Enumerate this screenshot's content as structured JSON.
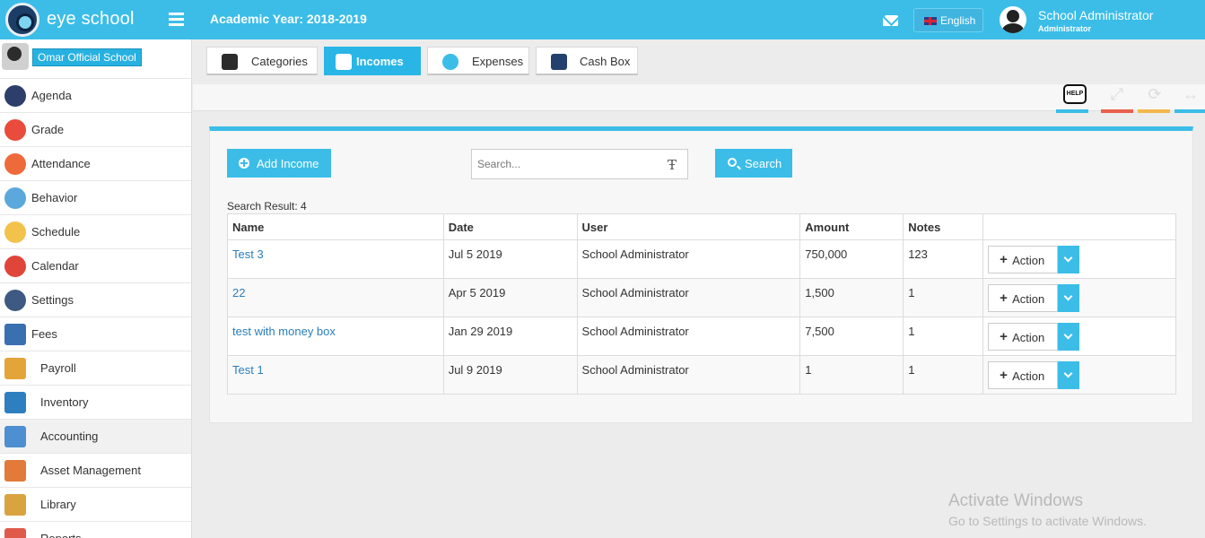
{
  "header": {
    "brand": "eye school",
    "academic_year": "Academic Year: 2018-2019",
    "language": "English",
    "user_name": "School Administrator",
    "user_role": "Administrator"
  },
  "sidebar": {
    "school_name": "Omar Official School",
    "items": [
      {
        "label": "Agenda",
        "icon": "agenda-icon",
        "color": "#2d3e6b"
      },
      {
        "label": "Grade",
        "icon": "grade-icon",
        "color": "#e94b3c"
      },
      {
        "label": "Attendance",
        "icon": "attendance-icon",
        "color": "#ef6a3a"
      },
      {
        "label": "Behavior",
        "icon": "behavior-icon",
        "color": "#5aa8dc"
      },
      {
        "label": "Schedule",
        "icon": "schedule-icon",
        "color": "#f3c24a"
      },
      {
        "label": "Calendar",
        "icon": "calendar-icon",
        "color": "#e0453a"
      },
      {
        "label": "Settings",
        "icon": "settings-icon",
        "color": "#3f5a82"
      },
      {
        "label": "Fees",
        "icon": "fees-icon",
        "color": "#3a6fb0"
      },
      {
        "label": "Payroll",
        "icon": "payroll-icon",
        "color": "#e3a53a"
      },
      {
        "label": "Inventory",
        "icon": "inventory-icon",
        "color": "#2e7fbf"
      },
      {
        "label": "Accounting",
        "icon": "accounting-icon",
        "color": "#4d8fd1"
      },
      {
        "label": "Asset Management",
        "icon": "asset-management-icon",
        "color": "#e27a3a"
      },
      {
        "label": "Library",
        "icon": "library-icon",
        "color": "#d9a340"
      },
      {
        "label": "Reports",
        "icon": "reports-icon",
        "color": "#e05a4a"
      }
    ]
  },
  "tabs": [
    {
      "label": "Categories",
      "icon": "categories-icon",
      "color": "#2b2b2b"
    },
    {
      "label": "Incomes",
      "icon": "incomes-icon",
      "color": "#ffffff"
    },
    {
      "label": "Expenses",
      "icon": "expenses-icon",
      "color": "#3bbde8"
    },
    {
      "label": "Cash Box",
      "icon": "cash-box-icon",
      "color": "#24406e"
    }
  ],
  "toolbar": {
    "help_label": "HELP"
  },
  "panel": {
    "add_label": "Add Income",
    "search_placeholder": "Search...",
    "search_label": "Search",
    "result_text": "Search Result: 4"
  },
  "table": {
    "columns": [
      "Name",
      "Date",
      "User",
      "Amount",
      "Notes",
      ""
    ],
    "rows": [
      {
        "name": "Test 3",
        "date": "Jul 5 2019",
        "user": "School Administrator",
        "amount": "750,000",
        "notes": "123",
        "action": "Action"
      },
      {
        "name": "22",
        "date": "Apr 5 2019",
        "user": "School Administrator",
        "amount": "1,500",
        "notes": "1",
        "action": "Action"
      },
      {
        "name": "test with money box",
        "date": "Jan 29 2019",
        "user": "School Administrator",
        "amount": "7,500",
        "notes": "1",
        "action": "Action"
      },
      {
        "name": "Test 1",
        "date": "Jul 9 2019",
        "user": "School Administrator",
        "amount": "1",
        "notes": "1",
        "action": "Action"
      }
    ]
  },
  "watermark": {
    "title": "Activate Windows",
    "subtitle": "Go to Settings to activate Windows."
  },
  "colors": {
    "accent": "#3bbde8",
    "link": "#2a7fb8"
  }
}
